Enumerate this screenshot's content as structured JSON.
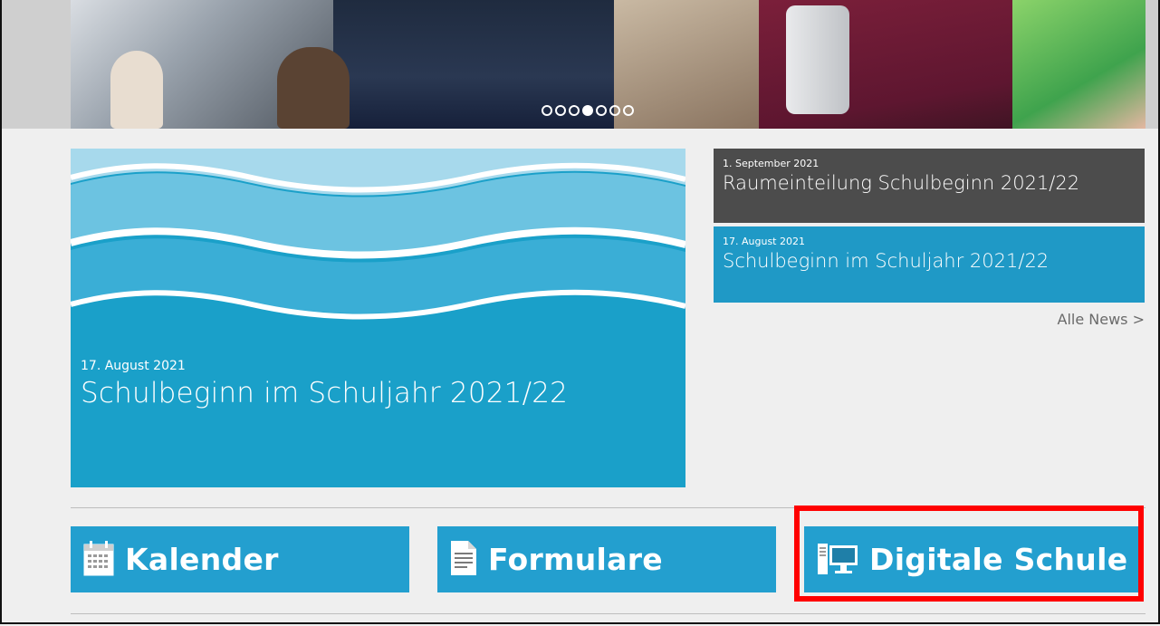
{
  "hero": {
    "slides_count": 7,
    "active_slide": 4
  },
  "feature": {
    "date": "17. August 2021",
    "title": "Schulbeginn im Schuljahr 2021/22"
  },
  "news": [
    {
      "date": "1. September 2021",
      "title": "Raumeinteilung Schulbeginn 2021/22"
    },
    {
      "date": "17. August 2021",
      "title": "Schulbeginn im Schuljahr 2021/22"
    }
  ],
  "all_news_label": "Alle News >",
  "tiles": {
    "calendar": {
      "label": "Kalender",
      "icon": "calendar-icon"
    },
    "forms": {
      "label": "Formulare",
      "icon": "document-icon"
    },
    "digital": {
      "label": "Digitale Schule",
      "icon": "computer-icon"
    }
  },
  "colors": {
    "accent": "#239fcf",
    "dark_news": "#4c4c4c",
    "highlight": "#ff0000"
  }
}
